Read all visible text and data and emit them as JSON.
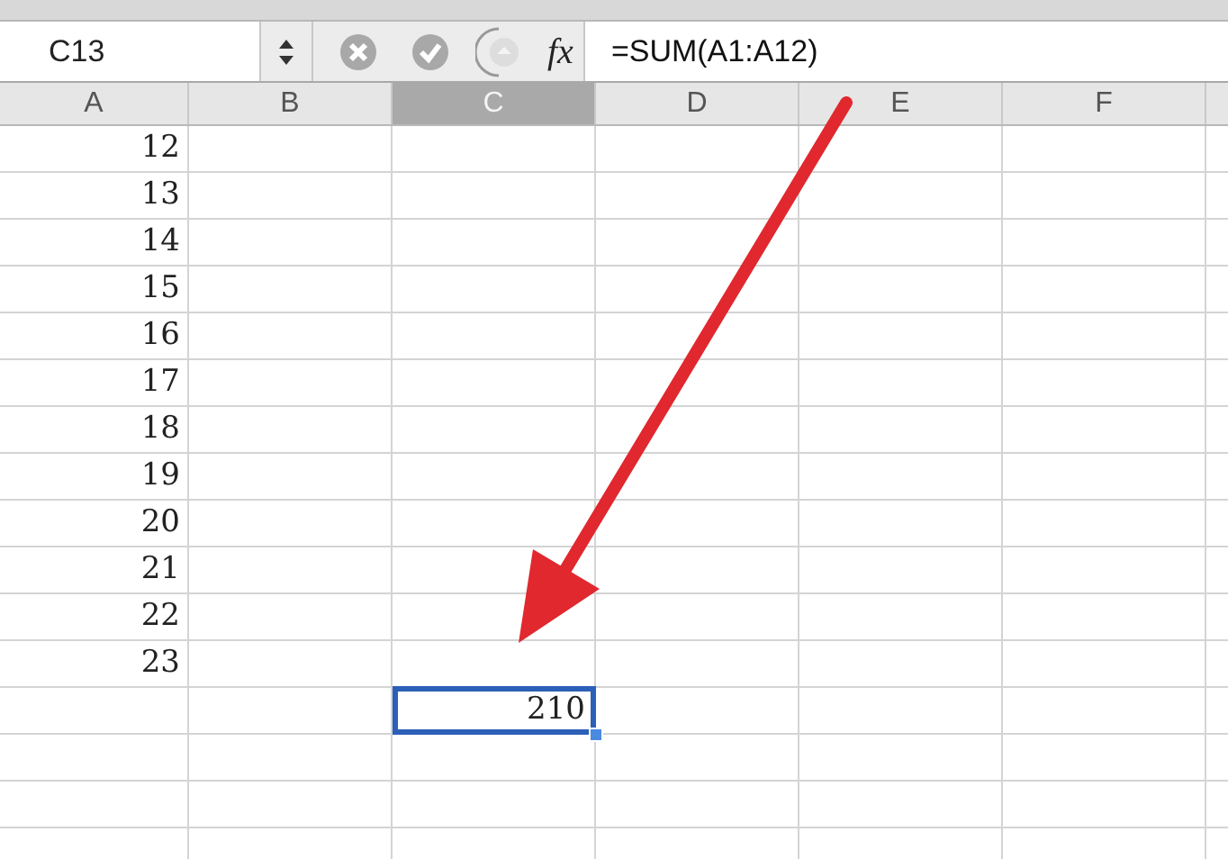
{
  "formula_bar": {
    "name_box": "C13",
    "function_label": "fx",
    "formula": "=SUM(A1:A12)"
  },
  "columns": [
    {
      "label": "A",
      "selected": false
    },
    {
      "label": "B",
      "selected": false
    },
    {
      "label": "C",
      "selected": true
    },
    {
      "label": "D",
      "selected": false
    },
    {
      "label": "E",
      "selected": false
    },
    {
      "label": "F",
      "selected": false
    }
  ],
  "rows": [
    {
      "A": "12",
      "selected": false
    },
    {
      "A": "13",
      "selected": false
    },
    {
      "A": "14",
      "selected": false
    },
    {
      "A": "15",
      "selected": false
    },
    {
      "A": "16",
      "selected": false
    },
    {
      "A": "17",
      "selected": false
    },
    {
      "A": "18",
      "selected": false
    },
    {
      "A": "19",
      "selected": false
    },
    {
      "A": "20",
      "selected": false
    },
    {
      "A": "21",
      "selected": false
    },
    {
      "A": "22",
      "selected": false
    },
    {
      "A": "23",
      "selected": false
    },
    {
      "C": "210",
      "selected": true
    },
    {
      "selected": false
    },
    {
      "selected": false
    },
    {
      "selected": false
    }
  ],
  "annotation": {
    "kind": "arrow"
  }
}
